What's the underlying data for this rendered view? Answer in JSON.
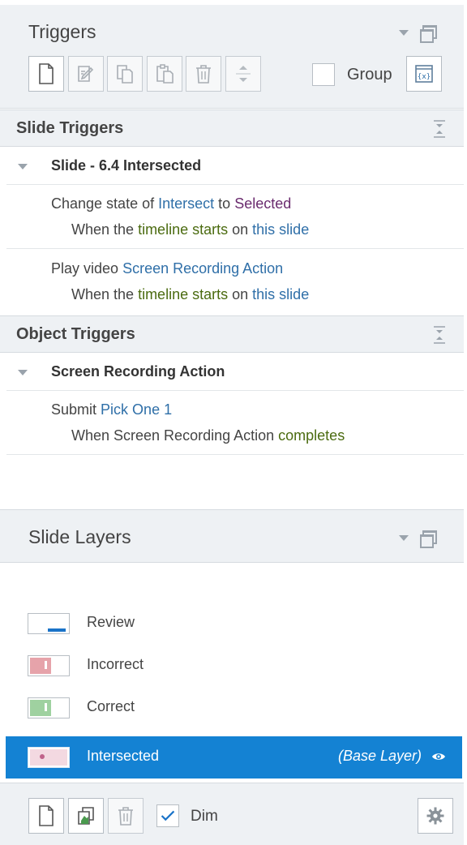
{
  "triggers_panel": {
    "title": "Triggers",
    "toolbar": {
      "new_icon": "new-trigger-icon",
      "edit_icon": "edit-trigger-icon",
      "copy_icon": "copy-icon",
      "paste_icon": "paste-icon",
      "delete_icon": "trash-icon",
      "move_icon": "up-down-arrows-icon",
      "variables_icon": "variables-icon"
    },
    "group_label": "Group",
    "group_checked": false
  },
  "slide_triggers": {
    "section_title": "Slide Triggers",
    "group_title": "Slide - 6.4 Intersected",
    "items": [
      {
        "action": "Change state of",
        "target": "Intersect",
        "connector": "to",
        "value": "Selected",
        "when": "When the",
        "event": "timeline starts",
        "on": "on",
        "object": "this slide"
      },
      {
        "action": "Play video",
        "target": "Screen Recording Action",
        "when": "When the",
        "event": "timeline starts",
        "on": "on",
        "object": "this slide"
      }
    ]
  },
  "object_triggers": {
    "section_title": "Object Triggers",
    "group_title": "Screen Recording Action",
    "items": [
      {
        "action": "Submit",
        "target": "Pick One 1",
        "when": "When Screen Recording Action",
        "event": "completes"
      }
    ]
  },
  "layers_panel": {
    "title": "Slide Layers",
    "layers": [
      {
        "name": "Review",
        "selected": false,
        "thumb_color": "#1a73c8"
      },
      {
        "name": "Incorrect",
        "selected": false,
        "thumb_color": "#e6a3aa"
      },
      {
        "name": "Correct",
        "selected": false,
        "thumb_color": "#9fd1a0"
      },
      {
        "name": "Intersected",
        "selected": true,
        "tag": "(Base Layer)",
        "visible": true,
        "thumb_color": "#f3d9e1"
      }
    ],
    "bottom": {
      "new_layer_icon": "new-layer-icon",
      "duplicate_layer_icon": "duplicate-layer-icon",
      "delete_layer_icon": "trash-icon",
      "dim_label": "Dim",
      "dim_checked": true,
      "settings_icon": "gear-icon"
    }
  },
  "colors": {
    "accent": "#1482d3",
    "link": "#2f6fa8",
    "value_purple": "#6a2b6e",
    "event_green": "#4b6b10",
    "panel_bg": "#eef1f4"
  }
}
